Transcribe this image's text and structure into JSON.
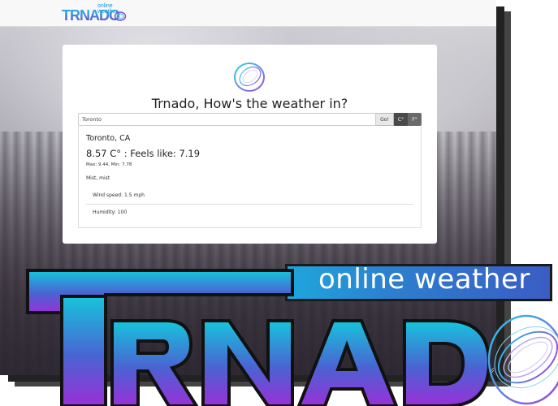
{
  "navbar": {
    "logo_word": "TRNADO",
    "logo_sub": "online weather"
  },
  "card": {
    "headline": "Trnado, How's the weather in?",
    "search": {
      "value": "Toronto",
      "placeholder": ""
    },
    "buttons": {
      "go": "Go!",
      "celsius": "C°",
      "fahrenheit": "F°"
    }
  },
  "result": {
    "city": "Toronto, CA",
    "temp_line": "8.57 C° : Feels like: 7.19",
    "maxmin": "Max: 9.44, Min: 7.78",
    "description": "Mist, mist",
    "wind": "Wind speed: 1.5 mph",
    "humidity": "Humidity: 100"
  },
  "big_logo": {
    "word": "TRNADO",
    "tagline": "online weather"
  },
  "colors": {
    "brand_cyan": "#1ec3e0",
    "brand_purple": "#8a2be2",
    "brand_blue": "#2c7fcf"
  }
}
